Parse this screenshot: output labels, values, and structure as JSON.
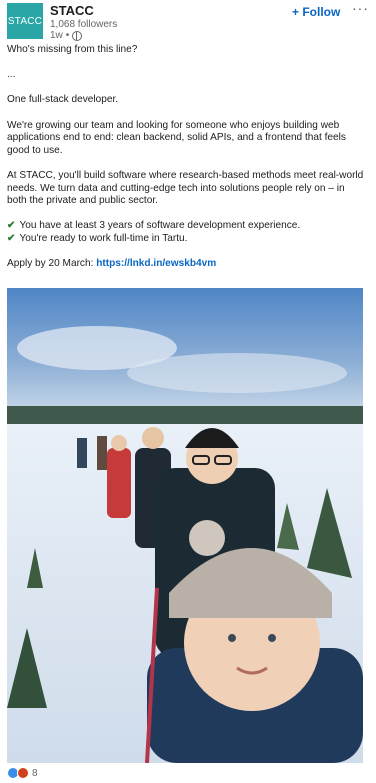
{
  "header": {
    "logo_text": "STACC",
    "company": "STACC",
    "followers": "1,068 followers",
    "time": "1w",
    "follow_label": "+ Follow",
    "more_label": "···"
  },
  "post": {
    "lines": [
      "Who's missing from this line?",
      "",
      "...",
      "",
      "One full-stack developer.",
      "",
      "We're growing our team and looking for someone who enjoys building web applications end to end: clean backend, solid APIs, and a frontend that feels good to use.",
      "",
      "At STACC, you'll build software where research-based methods meet real-world needs. We turn data and cutting-edge tech into solutions people rely on – in both the private and public sector.",
      ""
    ],
    "check1": "You have at least 3 years of software development experience.",
    "check2": "You're ready to work full-time in Tartu.",
    "apply_text": "Apply by 20 March: ",
    "apply_link": "https://lnkd.in/ewskb4vm"
  },
  "footer": {
    "reaction_count": "8"
  }
}
